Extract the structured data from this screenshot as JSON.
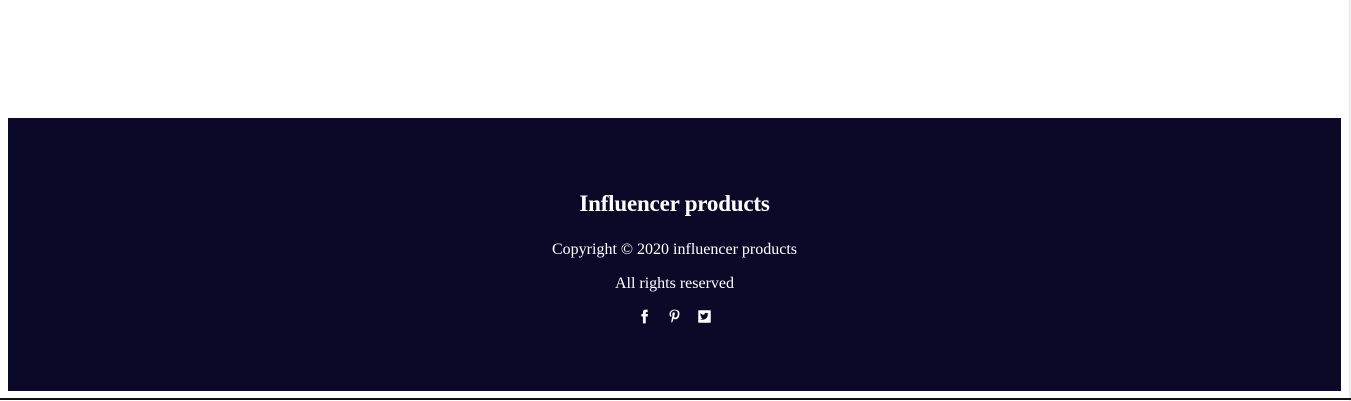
{
  "footer": {
    "title": "Influencer products",
    "copyright": "Copyright © 2020 influencer products",
    "rights": "All rights reserved",
    "social": [
      {
        "icon": "facebook-icon"
      },
      {
        "icon": "pinterest-icon"
      },
      {
        "icon": "twitter-icon"
      }
    ],
    "background_color": "#0b0828",
    "text_color": "#ffffff"
  }
}
